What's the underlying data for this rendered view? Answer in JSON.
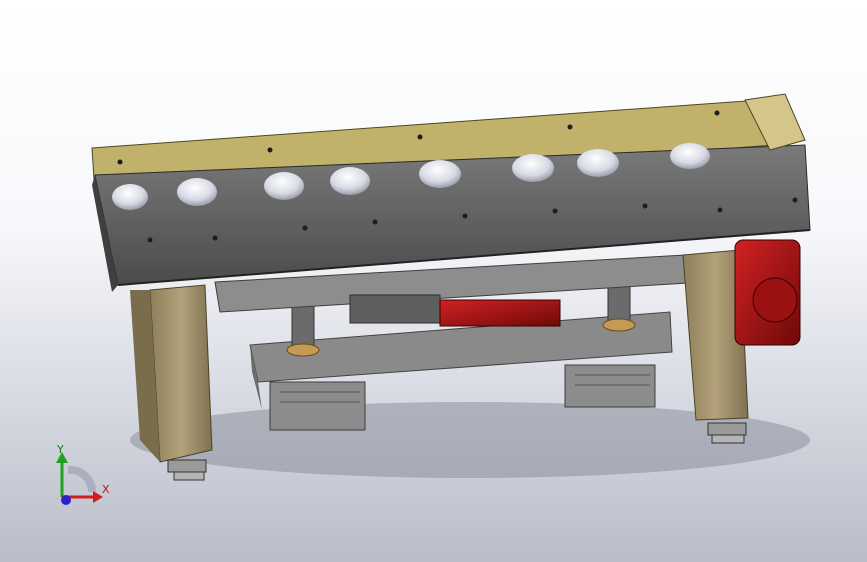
{
  "view": {
    "background_top": "#ffffff",
    "background_bottom": "#b9bdc8"
  },
  "model": {
    "frame_color": "#5e5e5e",
    "top_plate_color": "#9a8a45",
    "leg_color": "#a1916a",
    "motor_color": "#a40f0f",
    "roller_color": "#e6e8ef",
    "roller_count": 8
  },
  "triad": {
    "y_label": "Y",
    "x_label": "X",
    "y_color": "#1fa21f",
    "x_color": "#d21b1b",
    "z_color": "#2323c9"
  }
}
